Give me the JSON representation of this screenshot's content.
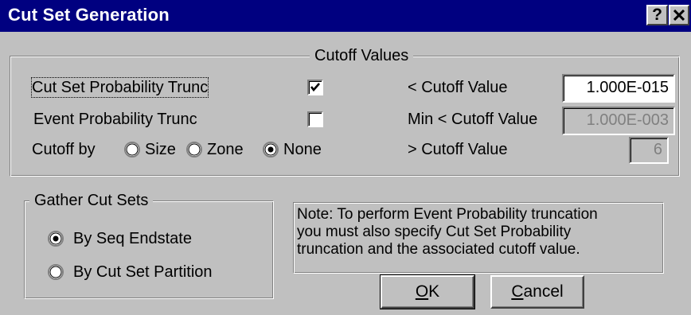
{
  "window": {
    "title": "Cut Set Generation",
    "help_label": "?",
    "close_label": "✕",
    "titlebar_color": "#000080",
    "face_color": "#c0c0c0"
  },
  "cutoff": {
    "legend": "Cutoff Values",
    "cut_set_trunc_label": "Cut Set Probability Trunc",
    "cut_set_trunc_checked": true,
    "event_trunc_label": "Event Probability Trunc",
    "event_trunc_checked": false,
    "cutoff_by_label": "Cutoff by",
    "options": [
      "Size",
      "Zone",
      "None"
    ],
    "selected_option": "None",
    "lt_cutoff_label": "< Cutoff Value",
    "lt_cutoff_value": "1.000E-015",
    "min_cutoff_label": "Min < Cutoff Value",
    "min_cutoff_value": "1.000E-003",
    "gt_cutoff_label": "> Cutoff Value",
    "gt_cutoff_value": "6"
  },
  "gather": {
    "legend": "Gather Cut Sets",
    "options": [
      "By Seq Endstate",
      "By Cut Set Partition"
    ],
    "selected_option": "By Seq Endstate"
  },
  "note": {
    "lines": [
      "Note: To perform Event Probability truncation",
      "you must also specify Cut Set Probability",
      "truncation and the associated cutoff value."
    ]
  },
  "buttons": {
    "ok_mnemonic": "O",
    "ok_rest": "K",
    "cancel_mnemonic": "C",
    "cancel_rest": "ancel"
  },
  "icons": {
    "checkmark": "checkmark-icon",
    "radio_selected": "radio-selected-icon",
    "radio_unselected": "radio-unselected-icon"
  }
}
